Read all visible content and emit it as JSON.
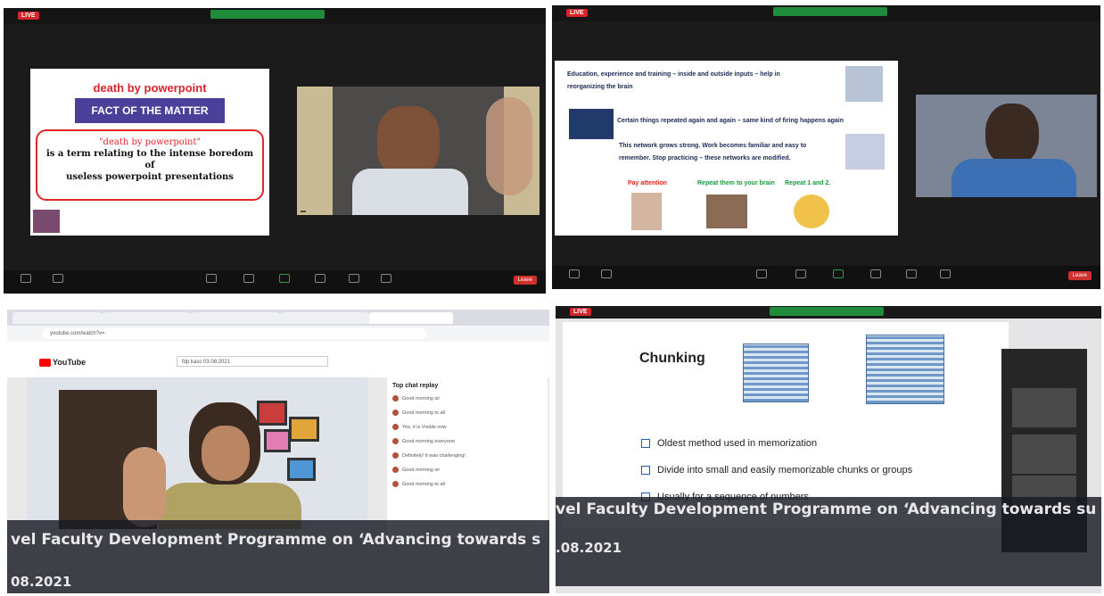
{
  "panels": {
    "p1": {
      "live": "LIVE",
      "slide_title": "death by powerpoint",
      "slide_fact": "FACT OF THE MATTER",
      "quote": "\"death by powerpoint\"",
      "line1": "is a term relating to the intense boredom",
      "line2": "of",
      "line3": "useless powerpoint presentations",
      "end": "Leave"
    },
    "p2": {
      "live": "LIVE",
      "line1a": "Education, experience and training – inside and outside inputs – help in",
      "line1b": "reorganizing the brain",
      "line2": "Certain things repeated again and again – same kind of firing happens again",
      "line3a": "This network grows strong. Work becomes familiar and easy to",
      "line3b": "remember. Stop practicing – these networks are modified.",
      "label_attention": "Pay attention",
      "label_repeat": "Repeat them to your brain",
      "label_repeat12": "Repeat 1 and 2.",
      "end": "Leave"
    },
    "p3": {
      "address": "youtube.com/watch?v=",
      "yt_logo": "YouTube",
      "search": "fdp kasc 03.08.2021",
      "chat_header": "Top chat replay",
      "chat": [
        "Good morning sir",
        "Good morning to all",
        "Yes, it is Visible now",
        "Good morning everyone",
        "Definitely! It was challenging!",
        "Good morning sir",
        "Good morning to all"
      ],
      "banner": "vel Faculty Development Programme on ‘Advancing towards s",
      "date": "08.2021"
    },
    "p4": {
      "live": "LIVE",
      "title": "Chunking",
      "bullet1": "Oldest method used in memorization",
      "bullet2": "Divide into small and easily memorizable chunks or groups",
      "bullet3": "Usually for a sequence of numbers",
      "banner": "vel Faculty Development Programme on ‘Advancing towards su",
      "date": ".08.2021"
    }
  },
  "colors": {
    "zoom_bg": "#1b1b1b",
    "live_red": "#d7232b",
    "fact_purple": "#4a3f99",
    "banner": "#181b24"
  }
}
